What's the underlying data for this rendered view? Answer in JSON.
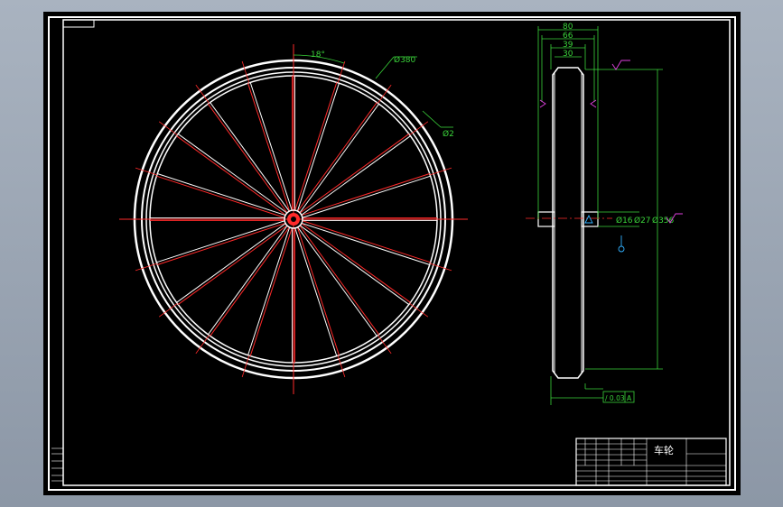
{
  "colors": {
    "background": "#000000",
    "outline": "#ffffff",
    "spoke": "#ff2a2a",
    "dimension": "#3ad33a",
    "symbol_magenta": "#e040e0",
    "symbol_cyan": "#30b0ff"
  },
  "front_view": {
    "spoke_count": 20,
    "dimensions": {
      "spoke_angle": "18°",
      "outer_diameter": "Ø380",
      "spoke_diameter": "Ø2"
    }
  },
  "side_view": {
    "dimensions": {
      "width_total": "80",
      "width_2": "66",
      "width_3": "39",
      "width_4": "30",
      "hub_bore": "Ø16",
      "hub_outer": "Ø27",
      "rim_diameter": "Ø356"
    },
    "tolerance_frame": "/ 0.03 A",
    "datum_label": "A"
  },
  "title_block": {
    "part_name": "车轮"
  }
}
